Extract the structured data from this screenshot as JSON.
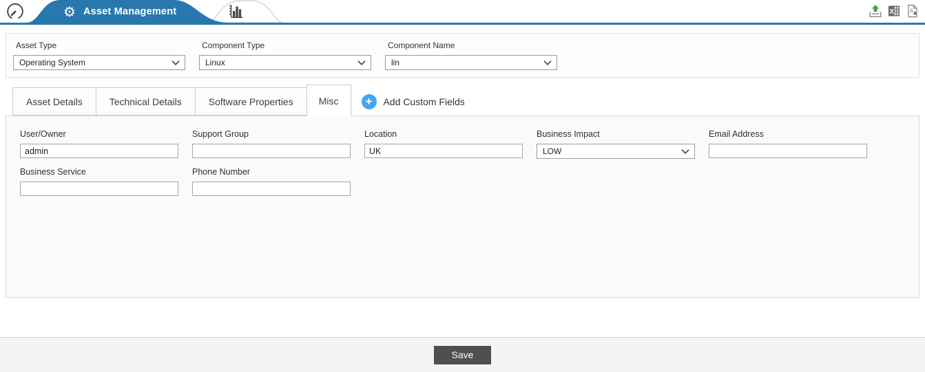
{
  "colors": {
    "accent_blue": "#2878ae",
    "plus_blue": "#45a4ef",
    "save_gray": "#4f4f4f",
    "export_green": "#3da33f"
  },
  "icons": {
    "gear": "⚙",
    "plus": "+"
  },
  "header": {
    "app_tab": {
      "label": "Asset Management"
    }
  },
  "filters": {
    "asset_type": {
      "label": "Asset Type",
      "value": "Operating System"
    },
    "component_type": {
      "label": "Component Type",
      "value": "Linux"
    },
    "component_name": {
      "label": "Component Name",
      "value": "lin"
    }
  },
  "tabs": {
    "items": [
      {
        "label": "Asset Details"
      },
      {
        "label": "Technical Details"
      },
      {
        "label": "Software Properties"
      },
      {
        "label": "Misc"
      }
    ],
    "active": "Misc",
    "add_custom_fields": {
      "label": "Add Custom Fields"
    }
  },
  "form": {
    "fields": [
      {
        "label": "User/Owner",
        "value": "admin",
        "type": "text"
      },
      {
        "label": "Support Group",
        "value": "",
        "type": "text"
      },
      {
        "label": "Location",
        "value": "UK",
        "type": "text"
      },
      {
        "label": "Business Impact",
        "value": "LOW",
        "type": "select"
      },
      {
        "label": "Email Address",
        "value": "",
        "type": "text"
      },
      {
        "label": "Business Service",
        "value": "",
        "type": "text"
      },
      {
        "label": "Phone Number",
        "value": "",
        "type": "text"
      }
    ]
  },
  "footer": {
    "save_label": "Save"
  }
}
